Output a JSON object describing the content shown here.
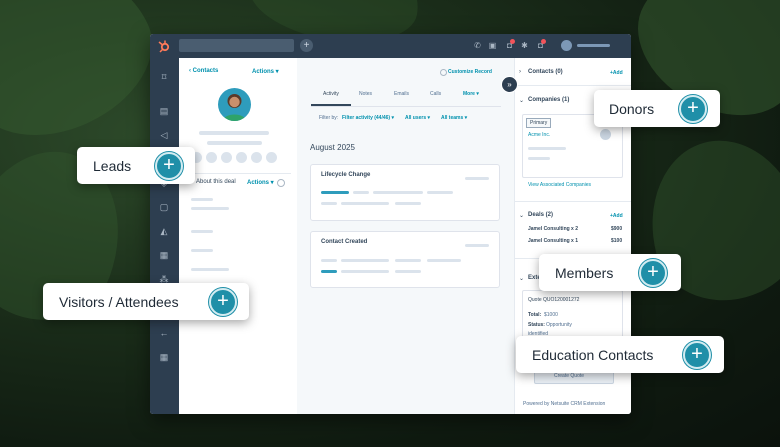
{
  "left_panel": {
    "back_link": "‹ Contacts",
    "actions": "Actions ▾",
    "about_title": "About this deal",
    "about_actions": "Actions ▾"
  },
  "middle_panel": {
    "customize_record": "Customize Record",
    "tabs": [
      "Activity",
      "Notes",
      "Emails",
      "Calls",
      "More ▾"
    ],
    "filter_by": "Filter by:",
    "filter_activity": "Filter activity (44/46) ▾",
    "all_users": "All users ▾",
    "all_teams": "All teams ▾",
    "month": "August 2025",
    "cards": [
      "Lifecycle Change",
      "Contact Created"
    ]
  },
  "right_panel": {
    "contacts_title": "Contacts (0)",
    "add": "+Add",
    "companies_title": "Companies (1)",
    "primary_badge": "Primary",
    "company_name": "Acme Inc.",
    "view_companies": "View Associated Companies",
    "deals_title": "Deals (2)",
    "deals": [
      {
        "name": "Jamel Consulting x 2",
        "amount": "$900"
      },
      {
        "name": "Jamel Consulting x 1",
        "amount": "$100"
      }
    ],
    "ext_title": "Exte",
    "quote_id": "Quote QUO120001272",
    "total_label": "Total:",
    "total_value": "$1000",
    "status_label": "Status:",
    "status_value": "Opportunity",
    "status_value2": "identified",
    "create_quote": "Create Quote",
    "powered_by": "Powered by Netsuite CRM Extension"
  },
  "callouts": {
    "leads": "Leads",
    "donors": "Donors",
    "visitors": "Visitors / Attendees",
    "members": "Members",
    "education": "Education Contacts"
  },
  "colors": {
    "topbar": "#2d3e50",
    "accent": "#0091ae",
    "plus_button": "#1f8fa8",
    "avatar_bg": "#2e9cbc"
  }
}
